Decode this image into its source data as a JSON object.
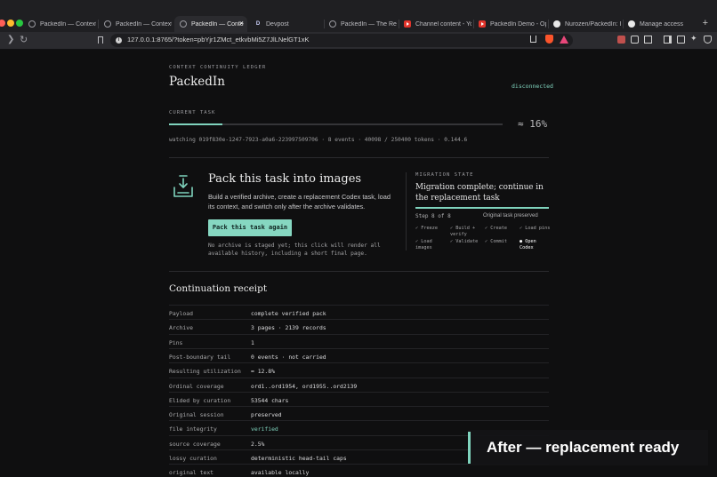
{
  "browser": {
    "tabs": [
      {
        "label": "PackedIn — Context le",
        "favicon": "globe-icon"
      },
      {
        "label": "PackedIn — Context le",
        "favicon": "globe-icon"
      },
      {
        "label": "PackedIn — Conte",
        "favicon": "globe-icon",
        "active": true
      },
      {
        "label": "Devpost",
        "favicon": "devpost-icon"
      },
      {
        "label": "PackedIn — The Reco",
        "favicon": "globe-icon"
      },
      {
        "label": "Channel content - Yo",
        "favicon": "youtube-icon"
      },
      {
        "label": "PackedIn Demo - Ope",
        "favicon": "youtube-icon"
      },
      {
        "label": "Nurozen/PackedIn: Im",
        "favicon": "github-icon"
      },
      {
        "label": "Manage access",
        "favicon": "github-icon"
      }
    ],
    "close_glyph": "×",
    "new_tab_glyph": "+",
    "url": "127.0.0.1:8765/?token=pbYjr1ZMct_etkvbMi5Z7JlLNelGT1xK"
  },
  "header": {
    "eyebrow": "CONTEXT CONTINUITY LEDGER",
    "title": "PackedIn",
    "status": "disconnected",
    "status_color": "#7fd3bd"
  },
  "task": {
    "eyebrow": "CURRENT TASK",
    "progress": 0.16,
    "percent_label": "≈ 16%",
    "watch_line": "watching 019f830e-1247-7923-a0a6-223997509706 · 8 events · 40098 / 250400 tokens · 0.144.6"
  },
  "pack": {
    "title": "Pack this task into images",
    "description": "Build a verified archive, create a replacement Codex task, load its context, and switch only after the archive validates.",
    "button": "Pack this task again",
    "note": "No archive is staged yet; this click will render all available history, including a short final page."
  },
  "migration": {
    "eyebrow": "MIGRATION STATE",
    "title": "Migration complete; continue in the replacement task",
    "step_label": "Step 8 of 8",
    "original_label": "Original task preserved",
    "steps": [
      {
        "label": "✓ Freeze",
        "current": false
      },
      {
        "label": "✓ Build + verify",
        "current": false
      },
      {
        "label": "✓ Create",
        "current": false
      },
      {
        "label": "✓ Load pins",
        "current": false
      },
      {
        "label": "✓ Load images",
        "current": false
      },
      {
        "label": "✓ Validate",
        "current": false
      },
      {
        "label": "✓ Commit",
        "current": false
      },
      {
        "label": "● Open Codex",
        "current": true
      }
    ]
  },
  "receipt": {
    "title": "Continuation receipt",
    "rows": [
      {
        "key": "Payload",
        "value": "complete verified pack",
        "good": false
      },
      {
        "key": "Archive",
        "value": "3 pages · 2139 records",
        "good": false
      },
      {
        "key": "Pins",
        "value": "1",
        "good": false
      },
      {
        "key": "Post-boundary tail",
        "value": "0 events · not carried",
        "good": false
      },
      {
        "key": "Resulting utilization",
        "value": "≈ 12.8%",
        "good": false
      },
      {
        "key": "Ordinal coverage",
        "value": "ord1..ord1954, ord1955..ord2139",
        "good": false
      },
      {
        "key": "Elided by curation",
        "value": "53544 chars",
        "good": false
      },
      {
        "key": "Original session",
        "value": "preserved",
        "good": false
      },
      {
        "key": "file integrity",
        "value": "verified",
        "good": true
      },
      {
        "key": "source coverage",
        "value": "2.5%",
        "good": false
      },
      {
        "key": "lossy curation",
        "value": "deterministic head-tail caps",
        "good": false
      },
      {
        "key": "original text",
        "value": "available locally",
        "good": false
      }
    ]
  },
  "caption": {
    "text": "After — replacement ready",
    "accent": "#7fd3bd"
  }
}
